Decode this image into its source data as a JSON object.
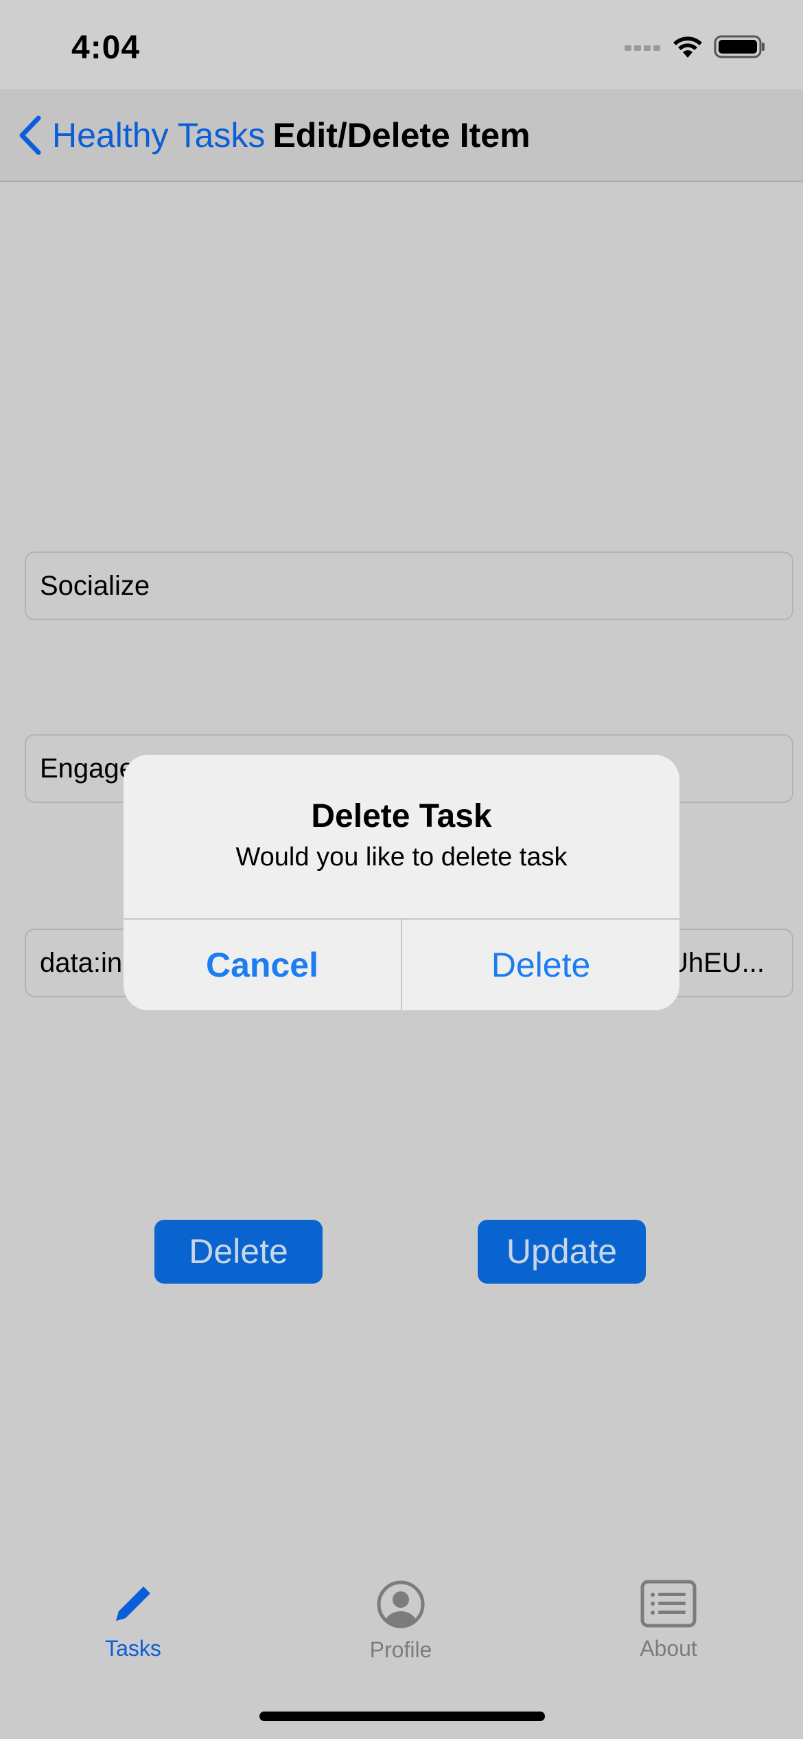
{
  "status": {
    "time": "4:04"
  },
  "nav": {
    "back_label": "Healthy Tasks",
    "title": "Edit/Delete Item"
  },
  "form": {
    "title_value": "Socialize",
    "description_value_visible": "Engage",
    "image_value_left": "data:in",
    "image_value_right": "UhEU..."
  },
  "buttons": {
    "delete_label": "Delete",
    "update_label": "Update"
  },
  "alert": {
    "title": "Delete Task",
    "message": "Would you like to delete task",
    "cancel_label": "Cancel",
    "delete_label": "Delete"
  },
  "tabs": [
    {
      "label": "Tasks",
      "icon": "pencil-icon",
      "active": true
    },
    {
      "label": "Profile",
      "icon": "person-circle-icon",
      "active": false
    },
    {
      "label": "About",
      "icon": "list-card-icon",
      "active": false
    }
  ],
  "colors": {
    "accent": "#0a64d0",
    "alert_button": "#1c7cf0",
    "tab_inactive": "#7c7c7c"
  }
}
